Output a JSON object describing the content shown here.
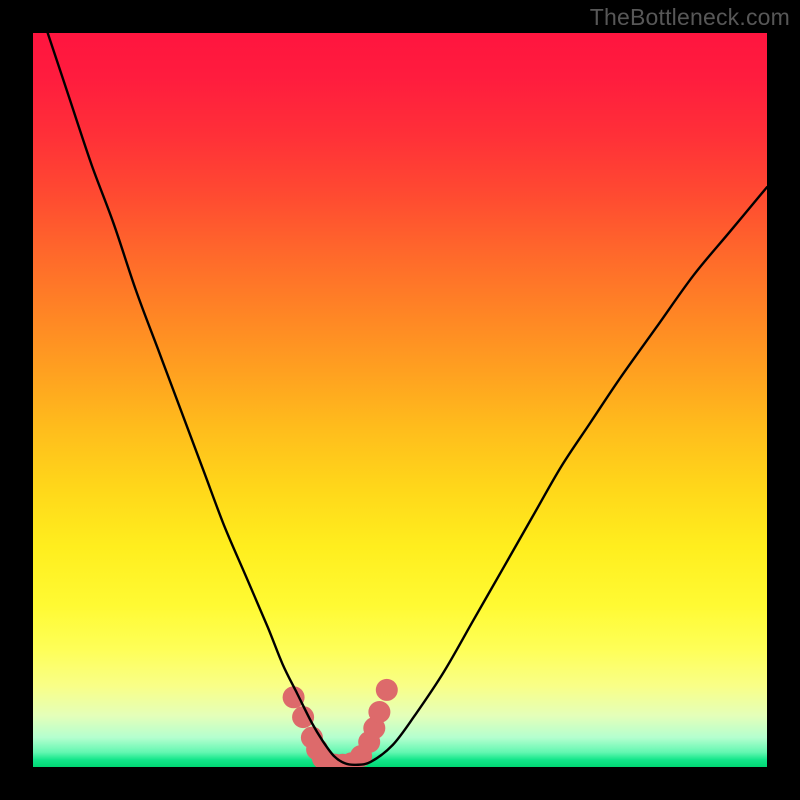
{
  "watermark": "TheBottleneck.com",
  "chart_data": {
    "type": "line",
    "title": "",
    "xlabel": "",
    "ylabel": "",
    "xlim": [
      0,
      100
    ],
    "ylim": [
      0,
      100
    ],
    "series": [
      {
        "name": "bottleneck-curve",
        "x": [
          2,
          5,
          8,
          11,
          14,
          17,
          20,
          23,
          26,
          29,
          32,
          34,
          36,
          38,
          39.5,
          41,
          42.5,
          44,
          46,
          49,
          52,
          56,
          60,
          64,
          68,
          72,
          76,
          80,
          85,
          90,
          95,
          100
        ],
        "y": [
          100,
          91,
          82,
          74,
          65,
          57,
          49,
          41,
          33,
          26,
          19,
          14,
          10,
          6,
          3.5,
          1.5,
          0.5,
          0.3,
          0.7,
          3,
          7,
          13,
          20,
          27,
          34,
          41,
          47,
          53,
          60,
          67,
          73,
          79
        ]
      }
    ],
    "marker_points": {
      "name": "highlight-dots",
      "x": [
        35.5,
        36.8,
        38,
        38.7,
        39.5,
        40.3,
        41.2,
        42.2,
        43.4,
        44.7,
        45.8,
        46.5,
        47.2,
        48.2
      ],
      "y": [
        9.5,
        6.8,
        4.0,
        2.4,
        1.2,
        0.5,
        0.3,
        0.3,
        0.5,
        1.5,
        3.4,
        5.3,
        7.5,
        10.5
      ]
    },
    "gradient_stops": [
      {
        "pos": 0.0,
        "color": "#ff153f"
      },
      {
        "pos": 0.3,
        "color": "#ff682b"
      },
      {
        "pos": 0.62,
        "color": "#ffd71a"
      },
      {
        "pos": 0.84,
        "color": "#feff58"
      },
      {
        "pos": 0.96,
        "color": "#b4ffcf"
      },
      {
        "pos": 1.0,
        "color": "#00d773"
      }
    ],
    "marker_color": "#dd6a6b",
    "curve_color": "#000000"
  }
}
